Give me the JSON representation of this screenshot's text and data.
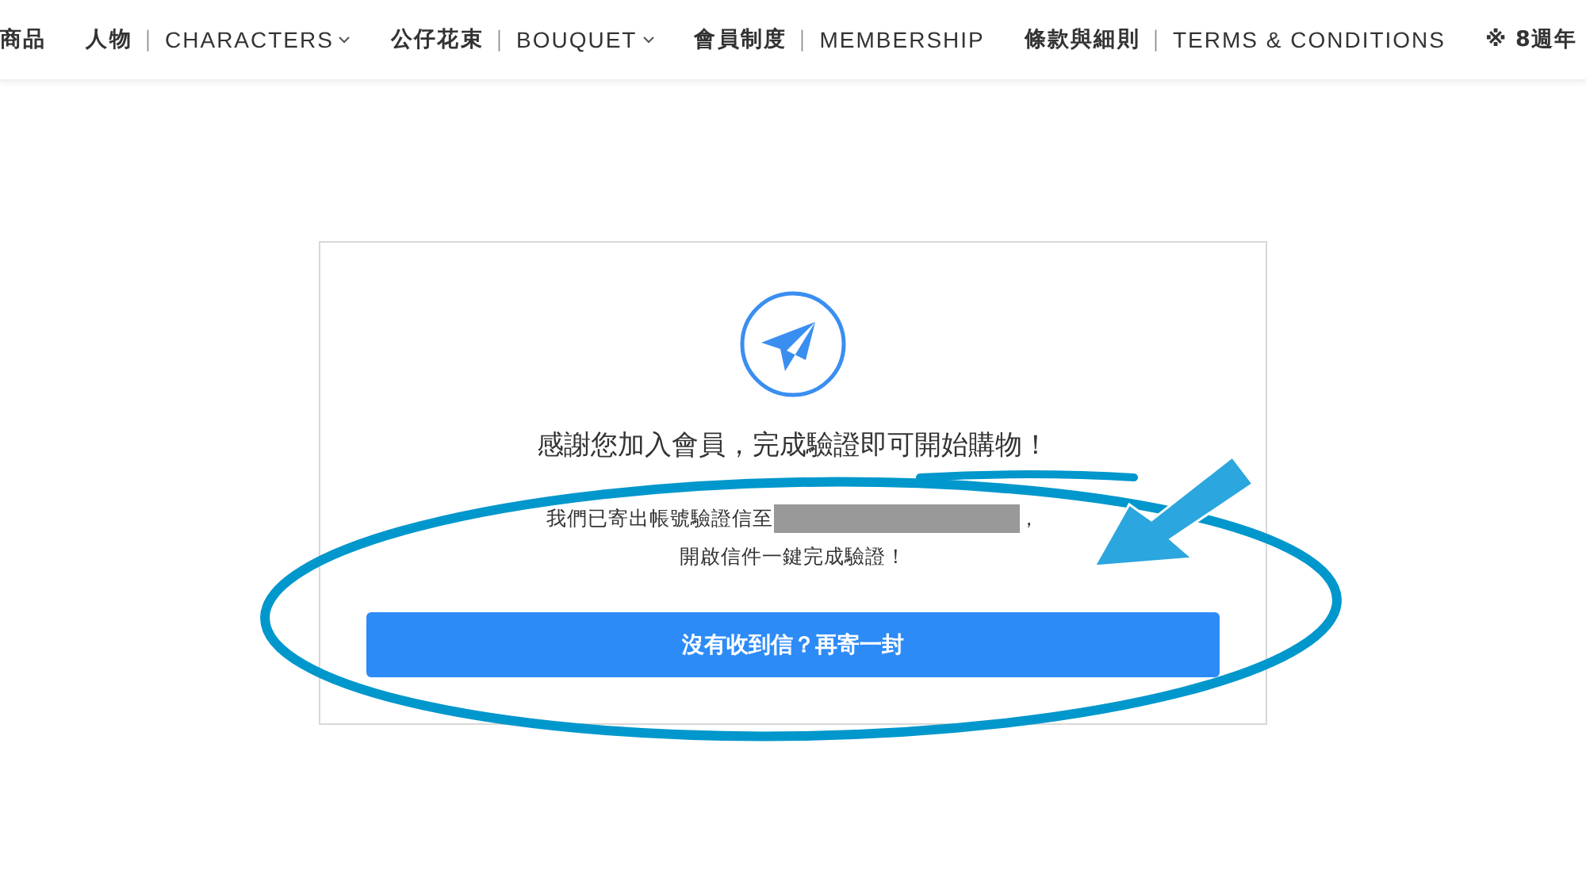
{
  "nav": [
    {
      "zh": "商品",
      "dropdown": false
    },
    {
      "zh": "人物",
      "en": "CHARACTERS",
      "dropdown": true
    },
    {
      "zh": "公仔花束",
      "en": "BOUQUET",
      "dropdown": true
    },
    {
      "zh": "會員制度",
      "en": "MEMBERSHIP",
      "dropdown": false
    },
    {
      "zh": "條款與細則",
      "en": "TERMS & CONDITIONS",
      "dropdown": false
    },
    {
      "zh": "※ 8週年",
      "dropdown": false
    }
  ],
  "separator": "｜",
  "card": {
    "title": "感謝您加入會員，完成驗證即可開始購物！",
    "sent_prefix": "我們已寄出帳號驗證信至",
    "sent_suffix": "，",
    "email_redacted": true,
    "instruction": "開啟信件一鍵完成驗證！",
    "button": "沒有收到信？再寄一封"
  }
}
